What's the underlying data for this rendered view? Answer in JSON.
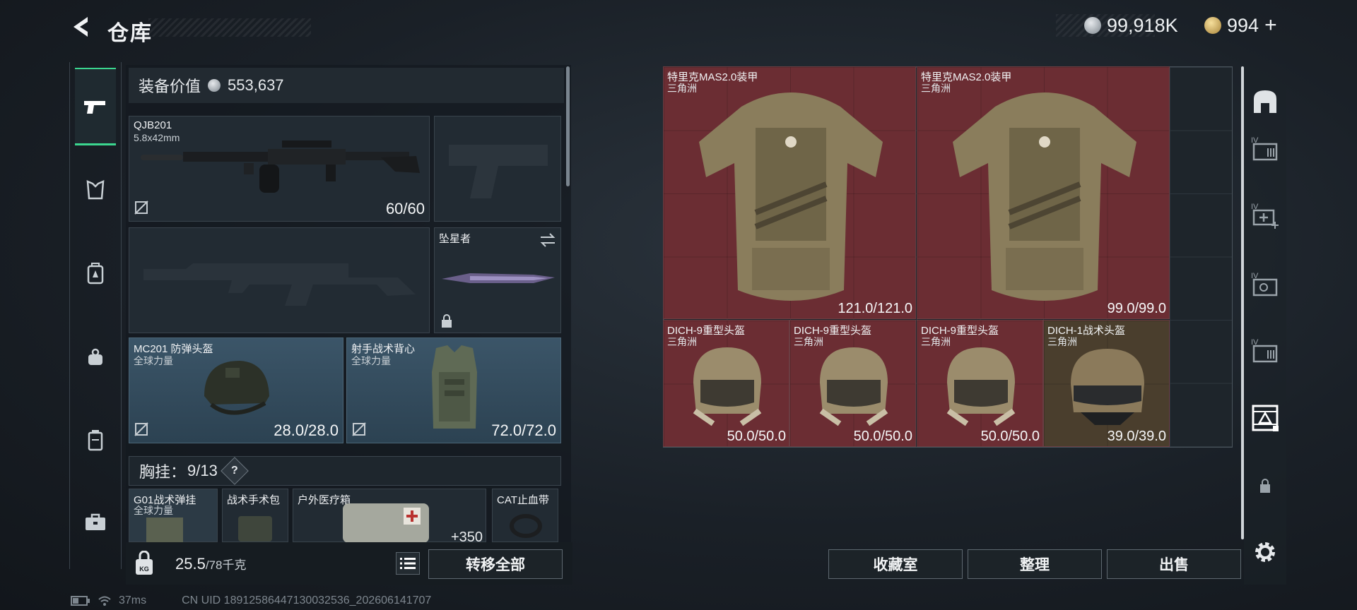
{
  "header": {
    "title": "仓库",
    "currency_main": "99,918K",
    "currency_premium": "994",
    "premium_add": "+"
  },
  "loadout": {
    "equip_value_label": "装备价值",
    "equip_value": "553,637",
    "primary": {
      "name": "QJB201",
      "caliber": "5.8x42mm",
      "ammo": "60/60"
    },
    "melee": {
      "name": "坠星者"
    },
    "helmet": {
      "name": "MC201 防弹头盔",
      "origin": "全球力量",
      "durability": "28.0/28.0"
    },
    "armor": {
      "name": "射手战术背心",
      "origin": "全球力量",
      "durability": "72.0/72.0"
    },
    "chest_rig": {
      "label": "胸挂：",
      "count": "9/13",
      "help": "?"
    },
    "chest_items": [
      {
        "name": "G01战术弹挂",
        "origin": "全球力量"
      },
      {
        "name": "战术手术包"
      },
      {
        "name": "户外医疗箱",
        "extra": "+350"
      },
      {
        "name": "CAT止血带"
      }
    ],
    "weight_value": "25.5",
    "weight_capacity": "/78千克",
    "transfer_all": "转移全部"
  },
  "storage": {
    "items": [
      {
        "name": "特里克MAS2.0装甲",
        "origin": "三角洲",
        "durability": "121.0/121.0"
      },
      {
        "name": "特里克MAS2.0装甲",
        "origin": "三角洲",
        "durability": "99.0/99.0"
      },
      {
        "name": "DICH-9重型头盔",
        "origin": "三角洲",
        "durability": "50.0/50.0"
      },
      {
        "name": "DICH-9重型头盔",
        "origin": "三角洲",
        "durability": "50.0/50.0"
      },
      {
        "name": "DICH-9重型头盔",
        "origin": "三角洲",
        "durability": "50.0/50.0"
      },
      {
        "name": "DICH-1战术头盔",
        "origin": "三角洲",
        "durability": "39.0/39.0"
      }
    ]
  },
  "actions": {
    "collection": "收藏室",
    "organize": "整理",
    "sell": "出售"
  },
  "status": {
    "ping": "37ms",
    "uid": "CN UID 18912586447130032536_202606141707"
  },
  "colors": {
    "accent": "#3bd68f",
    "item_red": "#6b2d33",
    "slot_blue": "#3b5568"
  }
}
